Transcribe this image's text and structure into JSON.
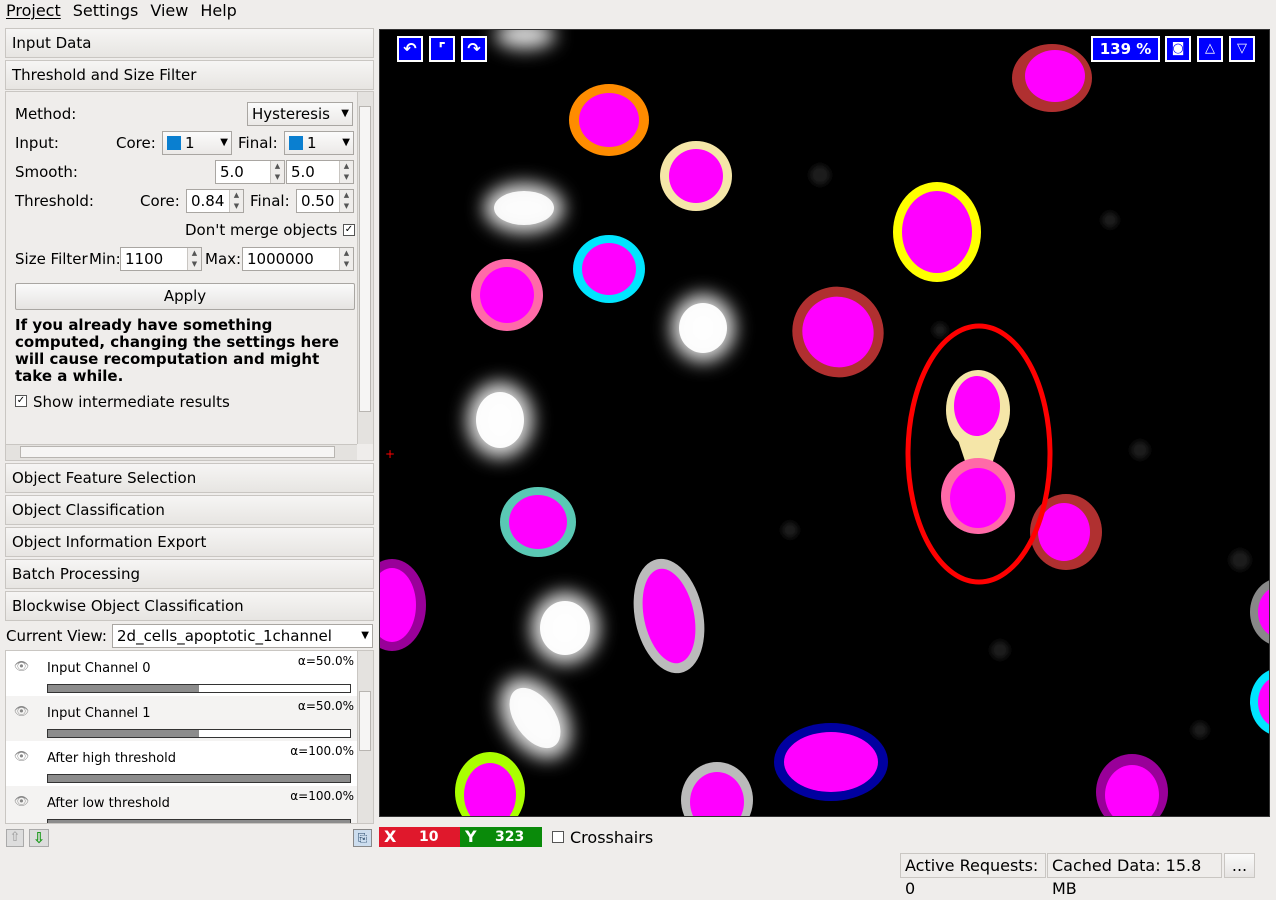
{
  "menu": [
    "Project",
    "Settings",
    "View",
    "Help"
  ],
  "accordion_top": [
    "Input Data",
    "Threshold and Size Filter"
  ],
  "threshold": {
    "method_label": "Method:",
    "method_value": "Hysteresis",
    "input_label": "Input:",
    "core_label": "Core:",
    "core_channel": "1",
    "final_label": "Final:",
    "final_channel": "1",
    "smooth_label": "Smooth:",
    "smooth_a": "5.0",
    "smooth_b": "5.0",
    "threshold_label": "Threshold:",
    "th_core_label": "Core:",
    "th_core": "0.84",
    "th_final_label": "Final:",
    "th_final": "0.50",
    "dont_merge_label": "Don't merge objects",
    "dont_merge_checked": "✓",
    "size_label": "Size Filter",
    "min_label": "Min:",
    "min_value": "1100",
    "max_label": "Max:",
    "max_value": "1000000",
    "apply_label": "Apply",
    "warning": "If you already have something computed, changing the settings here will cause recomputation and might take a while.",
    "show_intermediate_label": "Show intermediate results",
    "show_intermediate_checked": "✓"
  },
  "accordion_bottom": [
    "Object Feature Selection",
    "Object Classification",
    "Object Information Export",
    "Batch Processing",
    "Blockwise Object Classification"
  ],
  "current_view_label": "Current View:",
  "current_view_value": "2d_cells_apoptotic_1channel",
  "layers": [
    {
      "name": "Input Channel 0",
      "alpha": "α=50.0%",
      "opacity": 0.5
    },
    {
      "name": "Input Channel 1",
      "alpha": "α=50.0%",
      "opacity": 0.5
    },
    {
      "name": "After high threshold",
      "alpha": "α=100.0%",
      "opacity": 1.0
    },
    {
      "name": "After low threshold",
      "alpha": "α=100.0%",
      "opacity": 1.0
    }
  ],
  "viewer": {
    "zoom": "139 %"
  },
  "coords": {
    "x_label": "X",
    "x_value": "10",
    "y_label": "Y",
    "y_value": "323",
    "crosshairs_label": "Crosshairs"
  },
  "statusbar": {
    "active_requests": "Active Requests: 0",
    "cached": "Cached Data: 15.8 MB",
    "more": "..."
  },
  "colors": {
    "accent": "#0000ff",
    "highlight_ellipse": "#ff0000",
    "object_fill": "#ff00ff"
  }
}
